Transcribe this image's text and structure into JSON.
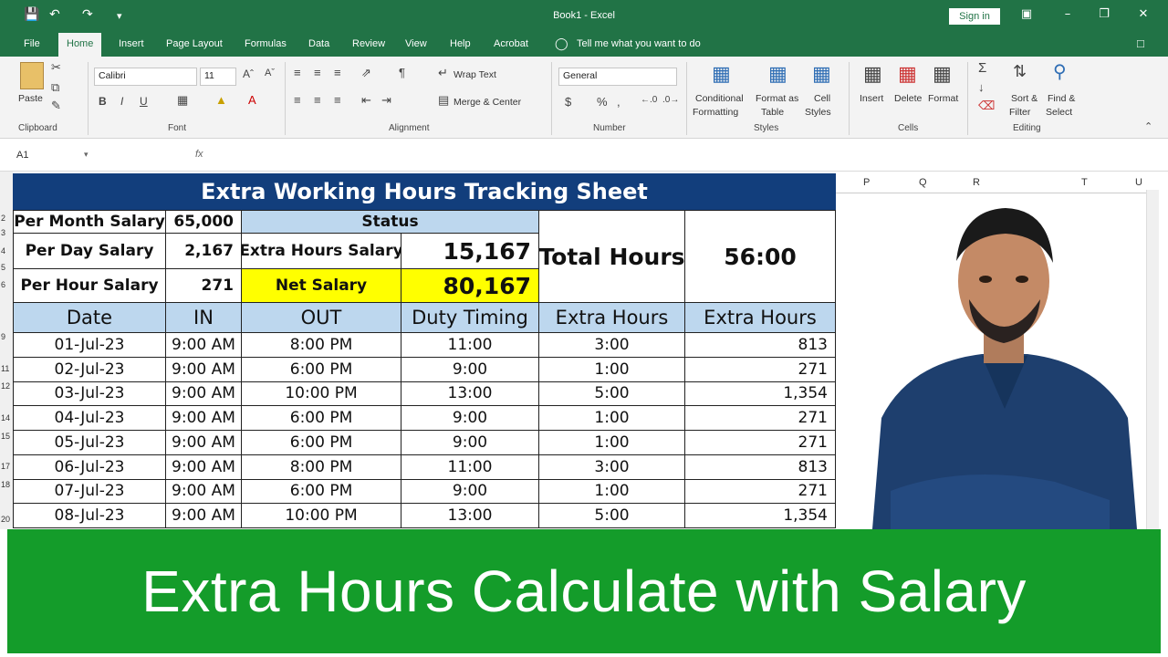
{
  "window": {
    "title": "Book1 - Excel",
    "sign_in": "Sign in"
  },
  "menu": [
    "File",
    "Home",
    "Insert",
    "Page Layout",
    "Formulas",
    "Data",
    "Review",
    "View",
    "Help",
    "Acrobat"
  ],
  "tell_me": "Tell me what you want to do",
  "ribbon": {
    "clipboard": {
      "paste": "Paste",
      "group": "Clipboard"
    },
    "font": {
      "name": "Calibri",
      "size": "11",
      "group": "Font",
      "bold": "B",
      "italic": "I",
      "underline": "U"
    },
    "alignment": {
      "wrap": "Wrap Text",
      "merge": "Merge & Center",
      "group": "Alignment"
    },
    "number": {
      "format": "General",
      "group": "Number",
      "currency": "$",
      "percent": "%"
    },
    "styles": {
      "conditional": "Conditional",
      "conditional2": "Formatting",
      "format_as": "Format as",
      "format_as2": "Table",
      "cell": "Cell",
      "cell2": "Styles",
      "group": "Styles"
    },
    "cells": {
      "insert": "Insert",
      "delete": "Delete",
      "format": "Format",
      "group": "Cells"
    },
    "editing": {
      "sort": "Sort &",
      "sort2": "Filter",
      "find": "Find &",
      "find2": "Select",
      "group": "Editing"
    }
  },
  "formula_bar": {
    "name_box": "A1",
    "fx": "fx"
  },
  "column_headers": [
    "P",
    "Q",
    "R",
    "T",
    "U"
  ],
  "row_numbers": [
    "2",
    "3",
    "4",
    "5",
    "6",
    "9",
    "11",
    "12",
    "14",
    "15",
    "17",
    "18",
    "20"
  ],
  "sheet": {
    "title": "Extra Working Hours Tracking Sheet",
    "per_month_label": "Per Month Salary",
    "per_month_value": "65,000",
    "per_day_label": "Per Day Salary",
    "per_day_value": "2,167",
    "per_hour_label": "Per Hour Salary",
    "per_hour_value": "271",
    "status_label": "Status",
    "extra_salary_label": "Extra Hours Salary",
    "extra_salary_value": "15,167",
    "net_salary_label": "Net Salary",
    "net_salary_value": "80,167",
    "total_hours_label": "Total Hours",
    "total_hours_value": "56:00",
    "headers": [
      "Date",
      "IN",
      "OUT",
      "Duty Timing",
      "Extra Hours",
      "Extra Hours"
    ],
    "rows": [
      [
        "01-Jul-23",
        "9:00 AM",
        "8:00 PM",
        "11:00",
        "3:00",
        "813"
      ],
      [
        "02-Jul-23",
        "9:00 AM",
        "6:00 PM",
        "9:00",
        "1:00",
        "271"
      ],
      [
        "03-Jul-23",
        "9:00 AM",
        "10:00 PM",
        "13:00",
        "5:00",
        "1,354"
      ],
      [
        "04-Jul-23",
        "9:00 AM",
        "6:00 PM",
        "9:00",
        "1:00",
        "271"
      ],
      [
        "05-Jul-23",
        "9:00 AM",
        "6:00 PM",
        "9:00",
        "1:00",
        "271"
      ],
      [
        "06-Jul-23",
        "9:00 AM",
        "8:00 PM",
        "11:00",
        "3:00",
        "813"
      ],
      [
        "07-Jul-23",
        "9:00 AM",
        "6:00 PM",
        "9:00",
        "1:00",
        "271"
      ],
      [
        "08-Jul-23",
        "9:00 AM",
        "10:00 PM",
        "13:00",
        "5:00",
        "1,354"
      ]
    ]
  },
  "banner": "Extra Hours Calculate with Salary",
  "colors": {
    "excel_green": "#217346",
    "banner_green": "#149c2a",
    "title_navy": "#123e7c",
    "header_blue": "#bdd7ee",
    "yellow": "#ffff00"
  }
}
